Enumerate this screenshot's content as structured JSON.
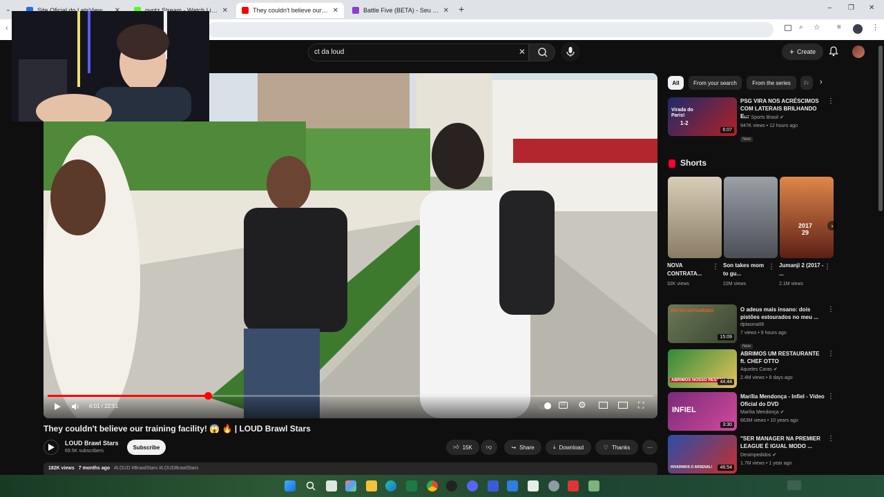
{
  "browser": {
    "tabs": [
      {
        "label": "Site Oficial do LetsView",
        "color": "#1a73e8"
      },
      {
        "label": "ovotz Stream - Watch Live on K",
        "color": "#53fc18"
      },
      {
        "label": "They couldn't believe our traini",
        "color": "#ff0000"
      },
      {
        "label": "Battle Five (BETA) - Seu Squad",
        "color": "#8b3fd1"
      }
    ]
  },
  "header": {
    "search_value": "ct da loud",
    "create_label": "Create"
  },
  "player": {
    "time": "6:01 / 22:51",
    "progress": 0.265
  },
  "video": {
    "title": "They couldn't believe our training facility! 😱 🔥 | LOUD Brawl Stars",
    "channel": "LOUD Brawl Stars",
    "subscribers": "69.5K subscribers",
    "subscribe_label": "Subscribe",
    "likes": "15K",
    "share_label": "Share",
    "download_label": "Download",
    "thanks_label": "Thanks",
    "views": "182K views",
    "age": "7 months ago",
    "tags": "#LOUD #BrawlStars #LOUDBrawlStars"
  },
  "sidebar": {
    "chips": [
      "All",
      "From your search",
      "From the series",
      "Fr"
    ],
    "first": {
      "title": "PSG VIRA NOS ACRÉSCIMOS COM LATERAIS BRILHANDO E...",
      "channel": "TNT Sports Brasil",
      "meta": "947K views • 12 hours ago",
      "badge": "New",
      "duration": "6:07"
    },
    "shorts_heading": "Shorts",
    "shorts": [
      {
        "title": "NOVA CONTRATA...",
        "views": "32K views"
      },
      {
        "title": "Son takes mom to gu...",
        "views": "22M views"
      },
      {
        "title": "Jumanji 2 (2017 - ...",
        "views": "2.1M views"
      }
    ],
    "shorts_overlay": [
      "2017",
      "29"
    ],
    "videos": [
      {
        "title": "O adeus mais insano: dois pistões estourados no meu ...",
        "channel": "dplasma06",
        "meta": "7 views • 9 hours ago",
        "badge": "New",
        "duration": "15:09",
        "overlay": "PISTÃO ESTOURADO"
      },
      {
        "title": "ABRIMOS UM RESTAURANTE ft. CHEF OTTO",
        "channel": "Aqueles Caras",
        "meta": "2.4M views • 8 days ago",
        "badge": "",
        "duration": "44:44",
        "overlay": "ABRIMOS NOSSO RESTAU"
      },
      {
        "title": "Marília Mendonça - Infiel - Vídeo Oficial do DVD",
        "channel": "Marília Mendonça",
        "meta": "663M views • 10 years ago",
        "badge": "",
        "duration": "3:30",
        "overlay": "INFIEL"
      },
      {
        "title": "\"SER MANAGER NA PREMIER LEAGUE É IGUAL MODO ...",
        "channel": "Desimpedidos",
        "meta": "1.7M views • 1 year ago",
        "badge": "",
        "duration": "46:54",
        "overlay": "INVADIMOS O ARSENAL!"
      }
    ]
  },
  "first_overlay": {
    "line1": "Virada do",
    "line2": "Paris!",
    "score": "1-2"
  }
}
